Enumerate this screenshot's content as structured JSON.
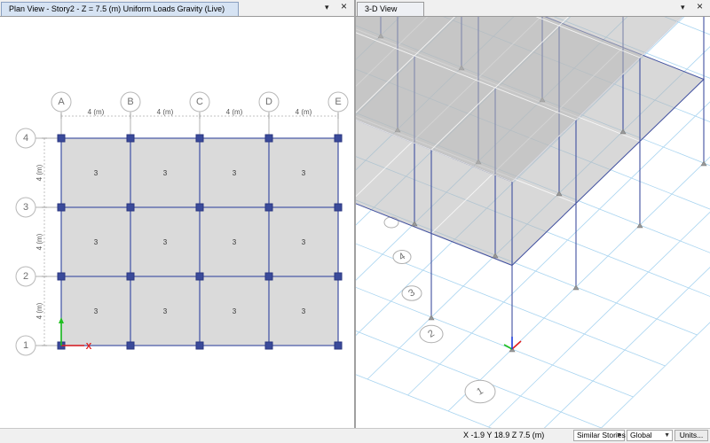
{
  "plan_view": {
    "tab_title": "Plan View - Story2 - Z = 7.5 (m)  Uniform Loads Gravity  (Live)",
    "controls": {
      "menu_glyph": "▾",
      "close_glyph": "×"
    },
    "grid_x_labels": [
      "A",
      "B",
      "C",
      "D",
      "E"
    ],
    "grid_y_labels": [
      "4",
      "3",
      "2",
      "1"
    ],
    "x_spacing_label": "4 (m)",
    "y_spacing_label": "4 (m)",
    "slab_load": "3",
    "axis_labels": {
      "x": "X",
      "y": "Y"
    },
    "colors": {
      "slab": "#dadada",
      "beam": "#4a5aa8",
      "support": "#3a4a9a",
      "x_axis": "#e02020",
      "y_axis": "#20c020"
    }
  },
  "view_3d": {
    "tab_title": "3-D View",
    "controls": {
      "menu_glyph": "▾",
      "close_glyph": "×"
    },
    "grid_labels": [
      "4",
      "3",
      "2",
      "1"
    ],
    "colors": {
      "grid": "#a8d4f0",
      "frame": "#4050a0",
      "slab": "#b8b8b8"
    }
  },
  "status_bar": {
    "coords": "X -1.9  Y 18.9  Z 7.5 (m)",
    "story_option": "Similar Stories",
    "coord_system": "Global",
    "units_label": "Units..."
  }
}
